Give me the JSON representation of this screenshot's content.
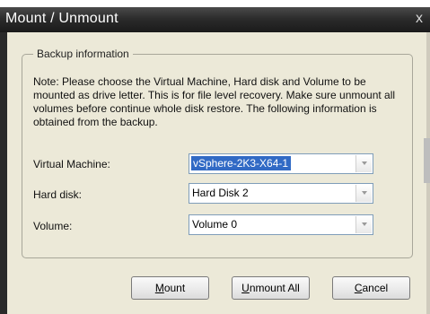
{
  "window": {
    "title": "Mount / Unmount",
    "close_glyph": "x"
  },
  "group": {
    "legend": "Backup information",
    "note": "Note: Please choose the Virtual Machine, Hard disk and Volume to be mounted as drive letter. This is for file level recovery. Make sure unmount all volumes before continue whole disk restore. The following information is obtained from the backup."
  },
  "fields": {
    "virtual_machine": {
      "label": "Virtual Machine:",
      "value": "vSphere-2K3-X64-1"
    },
    "hard_disk": {
      "label": "Hard disk:",
      "value": "Hard Disk 2"
    },
    "volume": {
      "label": "Volume:",
      "value": "Volume 0"
    }
  },
  "buttons": {
    "mount": {
      "mnemonic": "M",
      "rest": "ount"
    },
    "unmount_all": {
      "mnemonic": "U",
      "rest": "nmount All"
    },
    "cancel": {
      "mnemonic": "C",
      "rest": "ancel"
    }
  },
  "icons": {
    "close": "close-icon",
    "dropdown": "chevron-down-icon"
  }
}
